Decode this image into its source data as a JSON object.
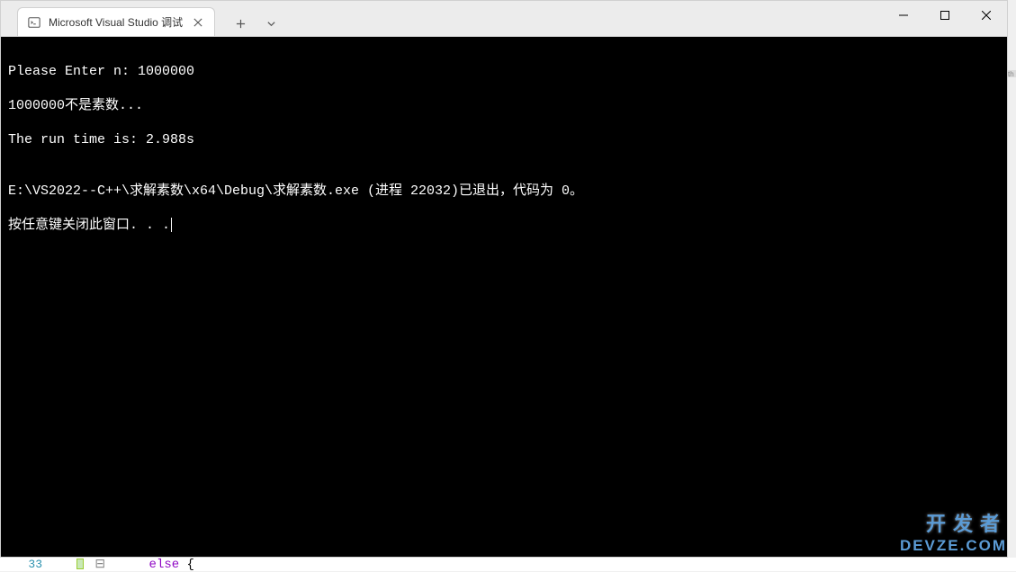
{
  "window": {
    "tab_title": "Microsoft Visual Studio 调试",
    "new_tab": "+",
    "tabs_dropdown": "⌄"
  },
  "console": {
    "line1": "Please Enter n: 1000000",
    "line2": "1000000不是素数...",
    "line3": "The run time is: 2.988s",
    "blank": "",
    "line4": "E:\\VS2022--C++\\求解素数\\x64\\Debug\\求解素数.exe (进程 22032)已退出，代码为 0。",
    "line5": "按任意键关闭此窗口. . ."
  },
  "editor": {
    "line_number": "33",
    "keyword": "else",
    "brace": " {"
  },
  "side": {
    "text": "th"
  },
  "watermark": {
    "line1": "开发者",
    "line2": "DEVZE.COM"
  }
}
